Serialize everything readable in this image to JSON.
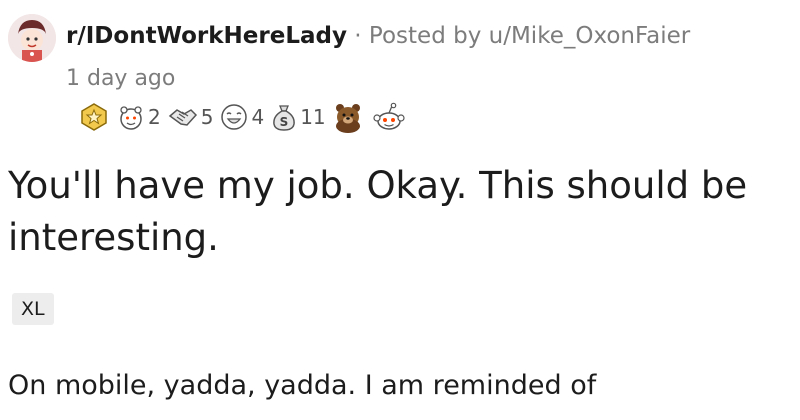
{
  "post": {
    "subreddit": "r/IDontWorkHereLady",
    "separator": "·",
    "posted_by": "Posted by u/Mike_OxonFaier",
    "age": "1 day ago",
    "awards": [
      {
        "icon": "gold-award-icon",
        "count": ""
      },
      {
        "icon": "wholesome-award-icon",
        "count": "2"
      },
      {
        "icon": "handshake-award-icon",
        "count": "5"
      },
      {
        "icon": "laughing-award-icon",
        "count": "4"
      },
      {
        "icon": "money-bag-award-icon",
        "count": "11"
      },
      {
        "icon": "bear-award-icon",
        "count": ""
      },
      {
        "icon": "snoo-award-icon",
        "count": ""
      }
    ],
    "title": "You'll have my job. Okay. This should be interesting.",
    "flair": "XL",
    "body": "On mobile, yadda, yadda. I am reminded of"
  }
}
